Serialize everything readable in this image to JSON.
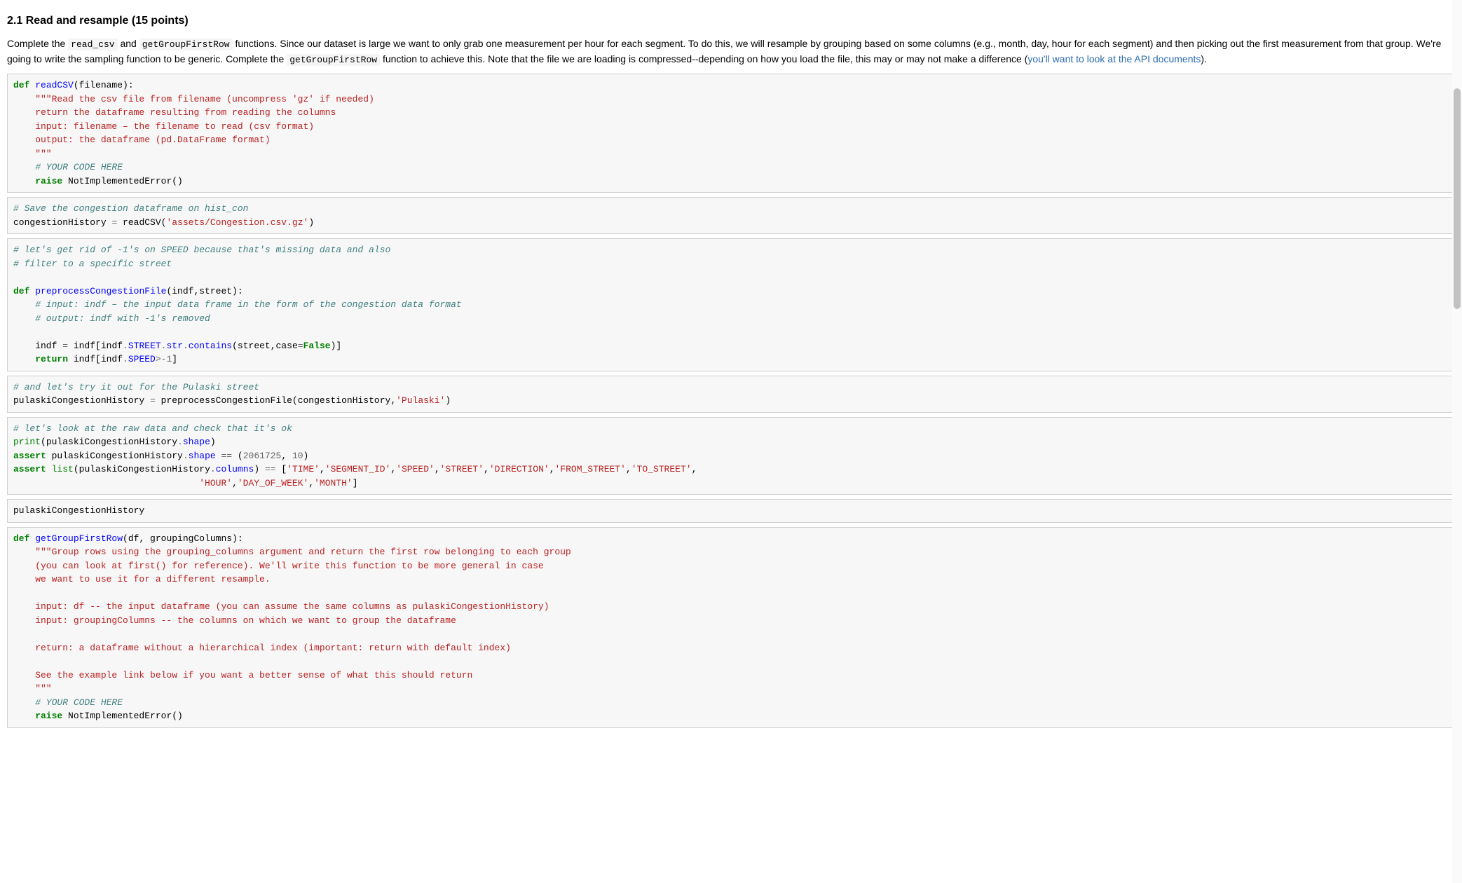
{
  "heading": "2.1 Read and resample (15 points)",
  "intro": {
    "p1a": "Complete the ",
    "code1": "read_csv",
    "p1b": " and ",
    "code2": "getGroupFirstRow",
    "p1c": " functions. Since our dataset is large we want to only grab one measurement per hour for each segment. To do this, we will resample by grouping based on some columns (e.g., month, day, hour for each segment) and then picking out the first measurement from that group. We're going to write the sampling function to be generic. Complete the ",
    "code3": "getGroupFirstRow",
    "p1d": " function to achieve this. Note that the file we are loading is compressed--depending on how you load the file, this may or may not make a difference (",
    "link": "you'll want to look at the API documents",
    "p1e": ")."
  },
  "cells": {
    "c1": {
      "def": "def",
      "fname": "readCSV",
      "args": "(filename):",
      "ds1": "    \"\"\"Read the csv file from filename (uncompress 'gz' if needed)",
      "ds2": "    return the dataframe resulting from reading the columns",
      "ds3": "    input: filename – the filename to read (csv format)",
      "ds4": "    output: the dataframe (pd.DataFrame format)",
      "ds5": "    \"\"\"",
      "c": "    # YOUR CODE HERE",
      "r": "    raise",
      "ni": " NotImplementedError()"
    },
    "c2": {
      "c": "# Save the congestion dataframe on hist_con",
      "l1a": "congestionHistory ",
      "op": "=",
      "l1b": " readCSV(",
      "s": "'assets/Congestion.csv.gz'",
      "l1c": ")"
    },
    "c3": {
      "c1": "# let's get rid of -1's on SPEED because that's missing data and also",
      "c2": "# filter to a specific street",
      "def": "def",
      "fname": "preprocessCongestionFile",
      "args": "(indf,street):",
      "dc1": "    # input: indf – the input data frame in the form of the congestion data format",
      "dc2": "    # output: indf with -1's removed",
      "l1a": "    indf ",
      "op1": "=",
      "l1b": " indf[indf",
      "dot1": ".",
      "attr1": "STREET",
      "dot2": ".",
      "attr2": "str",
      "dot3": ".",
      "attr3": "contains",
      "l1c": "(street,case",
      "op2": "=",
      "false": "False",
      "l1d": ")]",
      "ret": "    return",
      "l2a": " indf[indf",
      "dot4": ".",
      "attr4": "SPEED",
      "gt": ">-",
      "one": "1",
      "l2b": "]"
    },
    "c4": {
      "c": "# and let's try it out for the Pulaski street",
      "l1": "pulaskiCongestionHistory ",
      "op": "=",
      "l2": " preprocessCongestionFile(congestionHistory,",
      "s": "'Pulaski'",
      "l3": ")"
    },
    "c5": {
      "c": "# let's look at the raw data and check that it's ok",
      "pr": "print",
      "l1": "(pulaskiCongestionHistory",
      "dot1": ".",
      "attr1": "shape",
      "l1b": ")",
      "a1": "assert",
      "l2": " pulaskiCongestionHistory",
      "dot2": ".",
      "attr2": "shape",
      "sp2": " ",
      "eq": "==",
      "l2b": " (",
      "n1": "2061725",
      "cm1": ", ",
      "n2": "10",
      "l2c": ")",
      "a2": "assert",
      "sp3": " ",
      "list": "list",
      "l3": "(pulaskiCongestionHistory",
      "dot3": ".",
      "attr3": "columns",
      "l3b": ") ",
      "eq2": "==",
      "l3c": " [",
      "s1": "'TIME'",
      "cm2": ",",
      "s2": "'SEGMENT_ID'",
      "cm3": ",",
      "s3": "'SPEED'",
      "cm4": ",",
      "s4": "'STREET'",
      "cm5": ",",
      "s5": "'DIRECTION'",
      "cm6": ",",
      "s6": "'FROM_STREET'",
      "cm7": ",",
      "s7": "'TO_STREET'",
      "cm8": ",",
      "pad": "                                  ",
      "s8": "'HOUR'",
      "cm9": ",",
      "s9": "'DAY_OF_WEEK'",
      "cm10": ",",
      "s10": "'MONTH'",
      "l3d": "]"
    },
    "c6": {
      "l": "pulaskiCongestionHistory"
    },
    "c7": {
      "def": "def",
      "fname": "getGroupFirstRow",
      "args": "(df, groupingColumns):",
      "ds1": "    \"\"\"Group rows using the grouping_columns argument and return the first row belonging to each group",
      "ds2": "    (you can look at first() for reference). We'll write this function to be more general in case",
      "ds3": "    we want to use it for a different resample.",
      "ds5": "    input: df -- the input dataframe (you can assume the same columns as pulaskiCongestionHistory)",
      "ds6": "    input: groupingColumns -- the columns on which we want to group the dataframe",
      "ds8": "    return: a dataframe without a hierarchical index (important: return with default index)",
      "ds10": "    See the example link below if you want a better sense of what this should return",
      "ds11": "    \"\"\"",
      "c": "    # YOUR CODE HERE",
      "r": "    raise",
      "ni": " NotImplementedError()"
    }
  }
}
